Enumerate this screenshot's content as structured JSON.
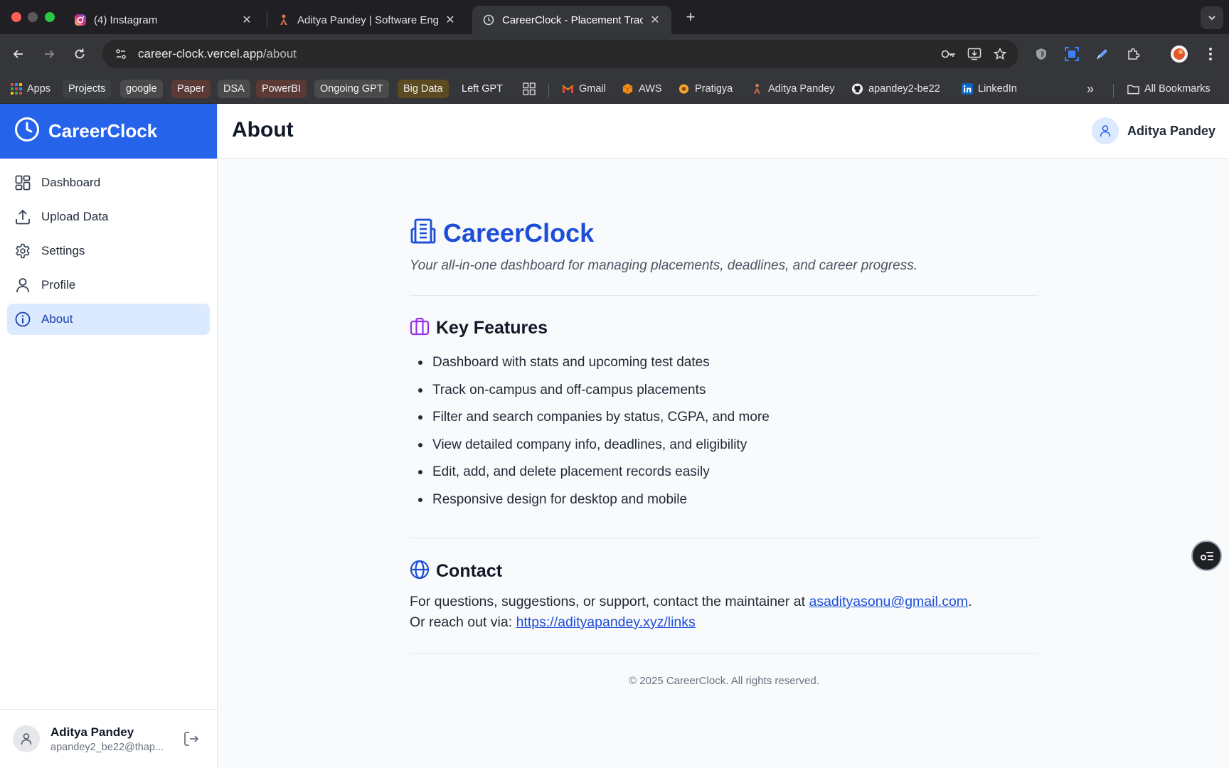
{
  "browser": {
    "tabs": [
      {
        "label": "(4) Instagram",
        "icon": "instagram-icon"
      },
      {
        "label": "Aditya Pandey | Software Engi",
        "icon": "person-icon"
      },
      {
        "label": "CareerClock - Placement Trac",
        "icon": "clock-icon",
        "active": true
      }
    ],
    "new_tab_label": "+",
    "url_domain": "career-clock.vercel.app",
    "url_path": "/about",
    "bookmarks": {
      "apps": "Apps",
      "chips": [
        {
          "label": "Projects",
          "color": "#3c4043"
        },
        {
          "label": "google",
          "color": "#4a4a4a"
        },
        {
          "label": "Paper",
          "color": "#5b3a36"
        },
        {
          "label": "DSA",
          "color": "#4a4a4a"
        },
        {
          "label": "PowerBI",
          "color": "#5b3a36"
        },
        {
          "label": "Ongoing GPT",
          "color": "#4a4a4a"
        },
        {
          "label": "Big Data",
          "color": "#5c4a20"
        },
        {
          "label": "Left GPT",
          "color": "#35363a"
        }
      ],
      "links": [
        "Gmail",
        "AWS",
        "Pratigya",
        "Aditya Pandey",
        "apandey2-be22",
        "LinkedIn"
      ],
      "overflow": "»",
      "all_bookmarks": "All Bookmarks"
    }
  },
  "sidebar": {
    "brand": "CareerClock",
    "items": [
      {
        "label": "Dashboard",
        "icon": "dashboard-icon"
      },
      {
        "label": "Upload Data",
        "icon": "upload-icon"
      },
      {
        "label": "Settings",
        "icon": "gear-icon"
      },
      {
        "label": "Profile",
        "icon": "user-icon"
      },
      {
        "label": "About",
        "icon": "info-icon",
        "active": true
      }
    ],
    "user": {
      "name": "Aditya Pandey",
      "email": "apandey2_be22@thap..."
    }
  },
  "header": {
    "title": "About",
    "user_name": "Aditya Pandey"
  },
  "about": {
    "title": "CareerClock",
    "tagline": "Your all-in-one dashboard for managing placements, deadlines, and career progress.",
    "features_title": "Key Features",
    "features": [
      "Dashboard with stats and upcoming test dates",
      "Track on-campus and off-campus placements",
      "Filter and search companies by status, CGPA, and more",
      "View detailed company info, deadlines, and eligibility",
      "Edit, add, and delete placement records easily",
      "Responsive design for desktop and mobile"
    ],
    "contact_title": "Contact",
    "contact_line1_prefix": "For questions, suggestions, or support, contact the maintainer at ",
    "contact_email": "asadityasonu@gmail.com",
    "contact_line1_suffix": ".",
    "contact_line2_prefix": "Or reach out via: ",
    "contact_link": "https://adityapandey.xyz/links",
    "footer": "© 2025 CareerClock. All rights reserved."
  },
  "colors": {
    "brand_blue": "#2563eb",
    "active_nav": "#dbeafe",
    "link": "#1d4ed8",
    "features_icon": "#9333ea"
  }
}
